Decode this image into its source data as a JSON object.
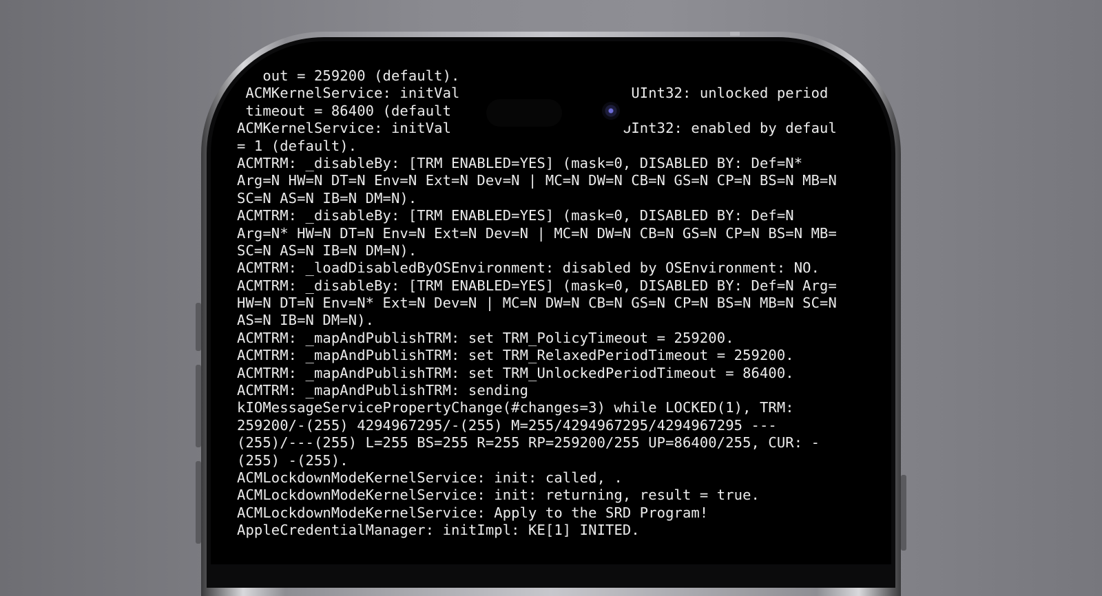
{
  "terminal": {
    "lines": [
      "   out = 259200 (default).",
      " ACMKernelService: initVal                    UInt32: unlocked period",
      " timeout = 86400 (default",
      "ACMKernelService: initVal                    UInt32: enabled by defaul",
      "= 1 (default).",
      "ACMTRM: _disableBy: [TRM ENABLED=YES] (mask=0, DISABLED BY: Def=N*",
      "Arg=N HW=N DT=N Env=N Ext=N Dev=N | MC=N DW=N CB=N GS=N CP=N BS=N MB=N",
      "SC=N AS=N IB=N DM=N).",
      "ACMTRM: _disableBy: [TRM ENABLED=YES] (mask=0, DISABLED BY: Def=N",
      "Arg=N* HW=N DT=N Env=N Ext=N Dev=N | MC=N DW=N CB=N GS=N CP=N BS=N MB=",
      "SC=N AS=N IB=N DM=N).",
      "ACMTRM: _loadDisabledByOSEnvironment: disabled by OSEnvironment: NO.",
      "ACMTRM: _disableBy: [TRM ENABLED=YES] (mask=0, DISABLED BY: Def=N Arg=",
      "HW=N DT=N Env=N* Ext=N Dev=N | MC=N DW=N CB=N GS=N CP=N BS=N MB=N SC=N",
      "AS=N IB=N DM=N).",
      "ACMTRM: _mapAndPublishTRM: set TRM_PolicyTimeout = 259200.",
      "ACMTRM: _mapAndPublishTRM: set TRM_RelaxedPeriodTimeout = 259200.",
      "ACMTRM: _mapAndPublishTRM: set TRM_UnlockedPeriodTimeout = 86400.",
      "ACMTRM: _mapAndPublishTRM: sending",
      "kIOMessageServicePropertyChange(#changes=3) while LOCKED(1), TRM:",
      "259200/-(255) 4294967295/-(255) M=255/4294967295/4294967295 ---",
      "(255)/---(255) L=255 BS=255 R=255 RP=259200/255 UP=86400/255, CUR: -",
      "(255) -(255).",
      "ACMLockdownModeKernelService: init: called, .",
      "ACMLockdownModeKernelService: init: returning, result = true.",
      "ACMLockdownModeKernelService: Apply to the SRD Program!",
      "AppleCredentialManager: initImpl: KE[1] INITED."
    ]
  },
  "colors": {
    "background": "#808086",
    "screen": "#000000",
    "text": "#ececec",
    "frame": "#c7c7cc"
  },
  "icons": {
    "camera": "front-camera-icon"
  }
}
